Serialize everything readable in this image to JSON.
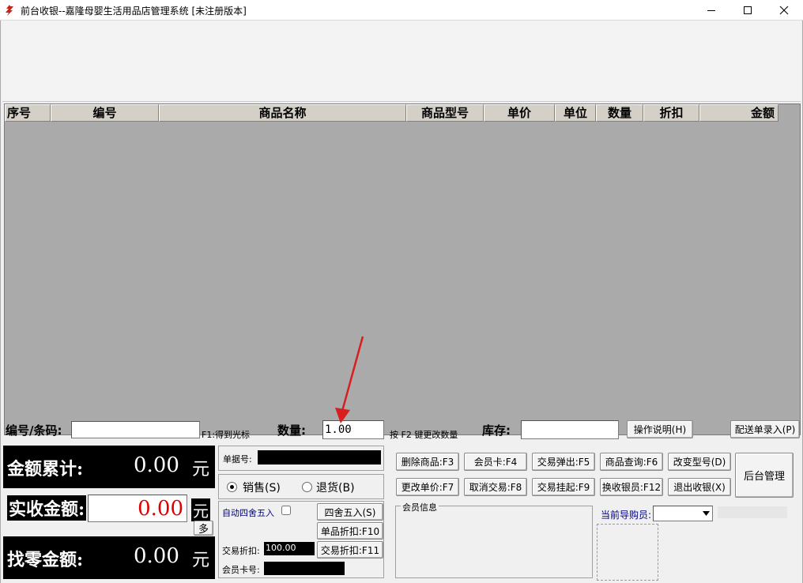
{
  "window": {
    "title": "前台收银--嘉隆母婴生活用品店管理系统 [未注册版本]"
  },
  "grid": {
    "columns": [
      "序号",
      "编号",
      "商品名称",
      "商品型号",
      "单价",
      "单位",
      "数量",
      "折扣",
      "金额"
    ]
  },
  "entry": {
    "code_label": "编号/条码:",
    "code_value": "",
    "f1_hint": "F1:得到光标",
    "qty_label": "数量:",
    "qty_value": "1.00",
    "f2_hint": "按 F2 键更改数量",
    "stock_label": "库存:",
    "stock_value": "",
    "help_button": "操作说明(H)",
    "delivery_button": "配送单录入(P)"
  },
  "totals": {
    "sum_label": "金额累计:",
    "sum_value": "0.00",
    "unit": "元",
    "received_label": "实收金额:",
    "received_value": "0.00",
    "received_unit": "元",
    "multi_button": "多",
    "change_label": "找零金额:",
    "change_value": "0.00",
    "change_unit": "元"
  },
  "middle": {
    "doc_no_label": "单据号:",
    "sale_label": "销售(S)",
    "return_label": "退货(B)",
    "auto_round_label": "自动四舍五入",
    "round_button": "四舍五入(S)",
    "item_discount_button": "单品折扣:F10",
    "trade_discount_label": "交易折扣:",
    "trade_discount_value": "100.00",
    "trade_discount_button": "交易折扣:F11",
    "member_card_label": "会员卡号:"
  },
  "actions": {
    "row1": [
      "删除商品:F3",
      "会员卡:F4",
      "交易弹出:F5",
      "商品查询:F6",
      "改变型号(D)"
    ],
    "row2": [
      "更改单价:F7",
      "取消交易:F8",
      "交易挂起:F9",
      "换收银员:F12",
      "退出收银(X)"
    ],
    "backend_button": "后台管理",
    "member_info_label": "会员信息",
    "guide_label": "当前导购员:"
  },
  "colors": {
    "grid_bg": "#aaaaaa",
    "received_value": "#e00000",
    "annotation_arrow": "#d81e1e",
    "guide_label": "#000080"
  }
}
